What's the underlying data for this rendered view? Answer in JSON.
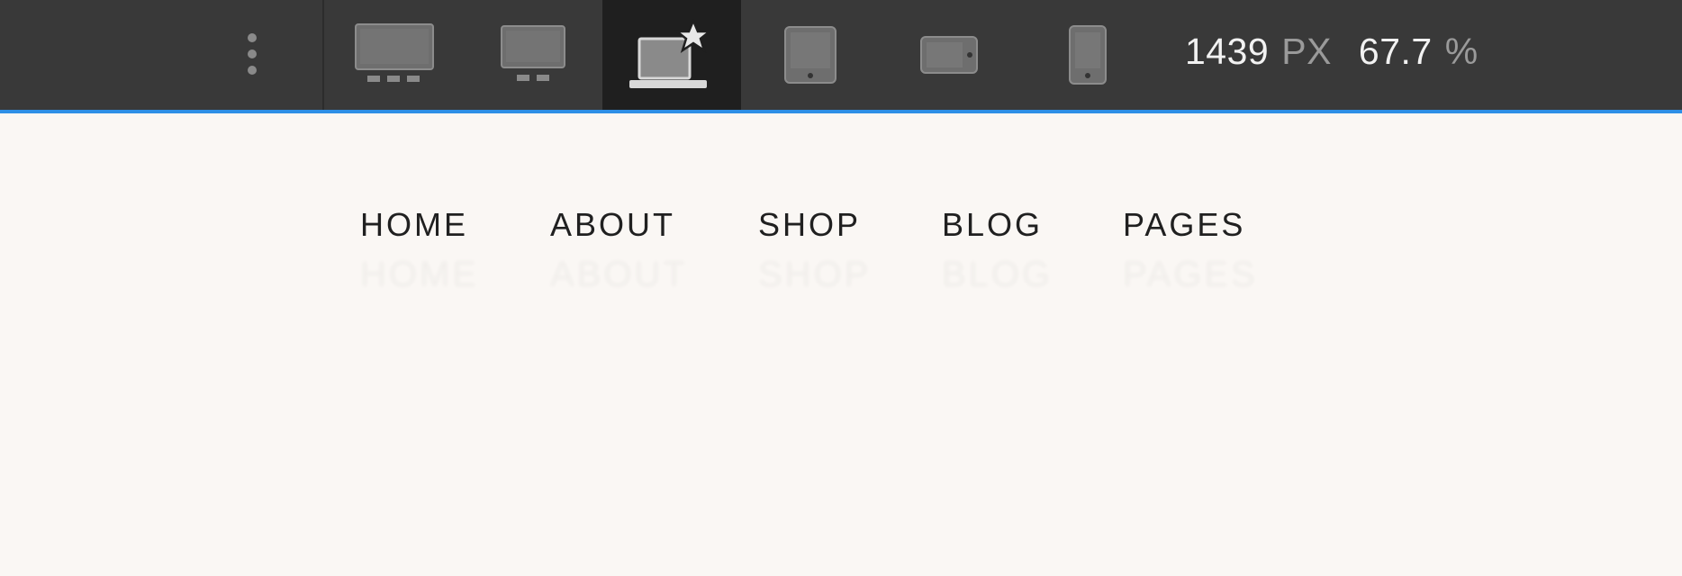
{
  "toolbar": {
    "menu_icon": "more-vertical-icon",
    "breakpoints": [
      {
        "id": "large-desktop",
        "icon": "large-desktop-icon",
        "active": false
      },
      {
        "id": "desktop",
        "icon": "desktop-icon",
        "active": false
      },
      {
        "id": "laptop-base",
        "icon": "laptop-star-icon",
        "active": true
      },
      {
        "id": "tablet-portrait",
        "icon": "tablet-portrait-icon",
        "active": false
      },
      {
        "id": "tablet-landscape",
        "icon": "tablet-landscape-icon",
        "active": false
      },
      {
        "id": "mobile",
        "icon": "mobile-icon",
        "active": false
      }
    ],
    "width_value": "1439",
    "width_unit": "PX",
    "zoom_value": "67.7",
    "zoom_unit": "%",
    "accent_color": "#2e8fe6",
    "background_color": "#393939"
  },
  "site": {
    "background_color": "#faf7f4",
    "nav": {
      "items": [
        {
          "label": "HOME"
        },
        {
          "label": "ABOUT"
        },
        {
          "label": "SHOP"
        },
        {
          "label": "BLOG"
        },
        {
          "label": "PAGES"
        }
      ]
    }
  }
}
